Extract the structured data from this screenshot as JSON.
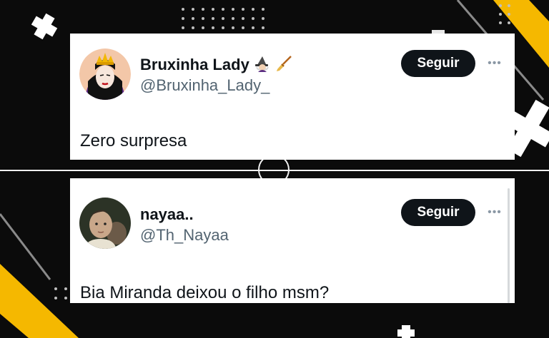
{
  "colors": {
    "background": "#0b0b0b",
    "accent": "#f5b800",
    "card": "#ffffff",
    "follow_button": "#0f1419",
    "handle": "#536471"
  },
  "posts": [
    {
      "display_name": "Bruxinha Lady",
      "handle": "@Bruxinha_Lady_",
      "emojis": [
        "witch-emoji",
        "broom-emoji"
      ],
      "follow_label": "Seguir",
      "more_label": "•••",
      "text": "Zero surpresa"
    },
    {
      "display_name": "nayaa..",
      "handle": "@Th_Nayaa",
      "follow_label": "Seguir",
      "more_label": "•••",
      "text": "Bia Miranda deixou o filho msm?"
    }
  ]
}
